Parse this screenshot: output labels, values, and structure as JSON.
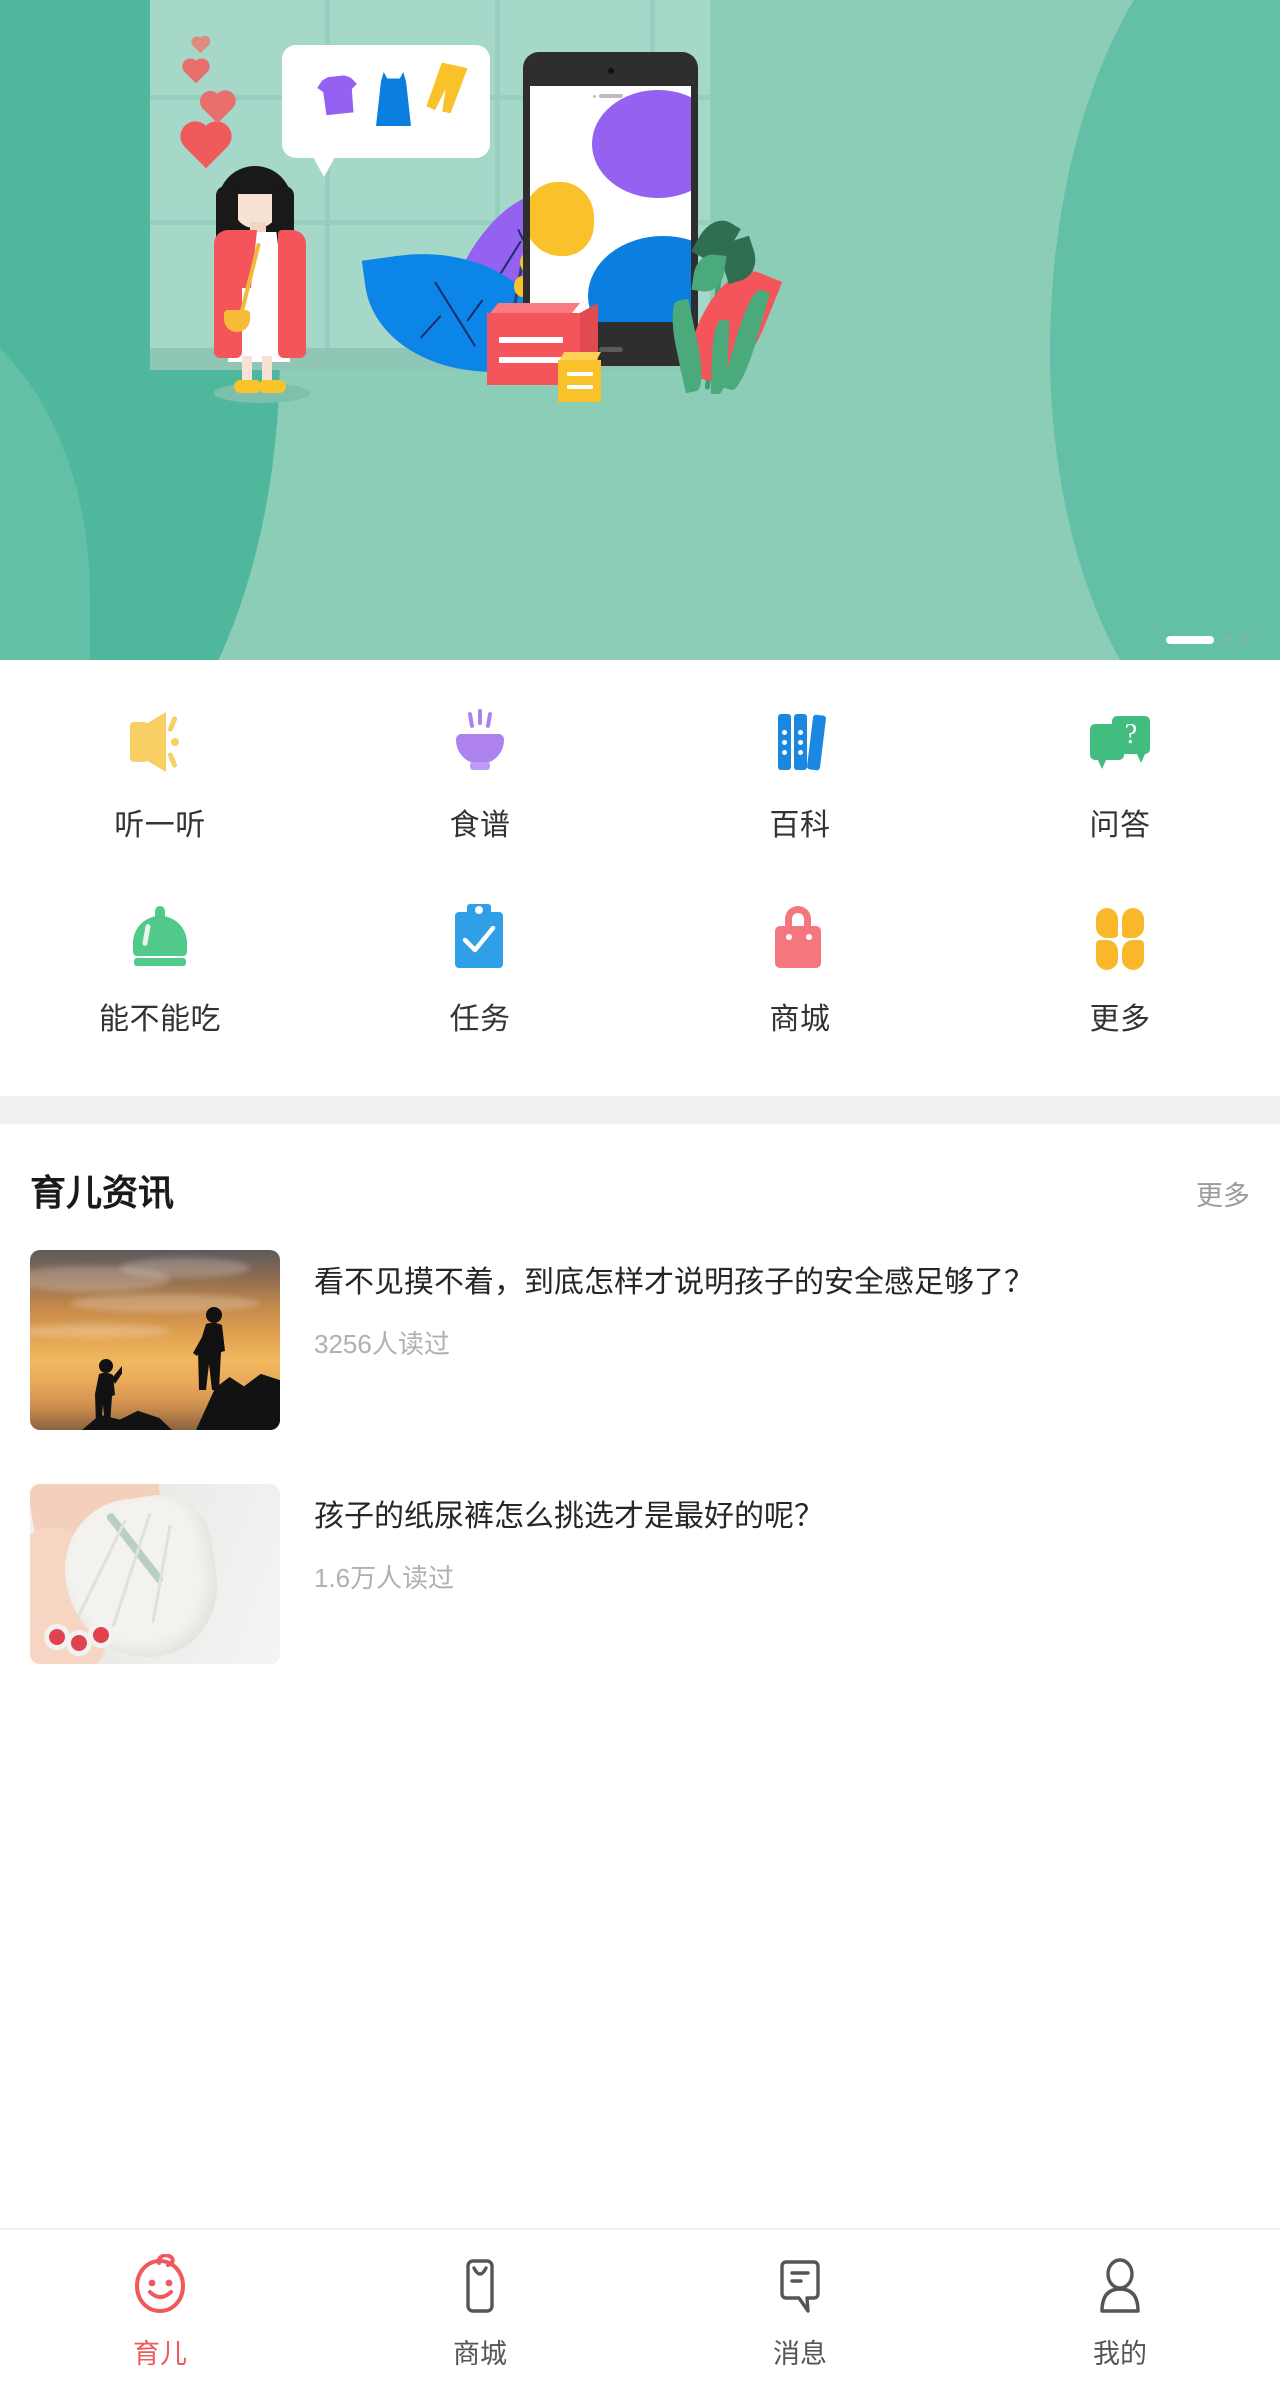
{
  "banner": {
    "name": "promo-banner",
    "slide_count": 3,
    "active_slide": 1,
    "indicator_active_color": "#ffffff",
    "indicator_inactive_color": "#76b9a5",
    "background_color": "#8ccdb8"
  },
  "quick_links": {
    "rows": [
      [
        {
          "label": "听一听",
          "icon": "speaker-icon",
          "color": "#f8cf62"
        },
        {
          "label": "食谱",
          "icon": "soup-bowl-icon",
          "color": "#ad82f0"
        },
        {
          "label": "百科",
          "icon": "books-icon",
          "color": "#1a87e0"
        },
        {
          "label": "问答",
          "icon": "question-chat-icon",
          "color": "#43bd7f"
        }
      ],
      [
        {
          "label": "能不能吃",
          "icon": "food-cover-icon",
          "color": "#51c98b"
        },
        {
          "label": "任务",
          "icon": "clipboard-check-icon",
          "color": "#2f9fe8"
        },
        {
          "label": "商城",
          "icon": "shopping-bag-icon",
          "color": "#f4777d"
        },
        {
          "label": "更多",
          "icon": "four-petal-grid-icon",
          "color": "#f9b72c"
        }
      ]
    ]
  },
  "news": {
    "section_title": "育儿资讯",
    "more_label": "更多",
    "articles": [
      {
        "title": "看不见摸不着，到底怎样才说明孩子的安全感足够了？",
        "meta": "3256人读过",
        "thumb": "sunset-helping-hand-photo"
      },
      {
        "title": "孩子的纸尿裤怎么挑选才是最好的呢？",
        "meta": "1.6万人读过",
        "thumb": "baby-diaper-photo"
      }
    ]
  },
  "tabbar": {
    "active_color": "#f0595c",
    "inactive_color": "#555555",
    "items": [
      {
        "label": "育儿",
        "icon": "baby-face-icon",
        "active": true
      },
      {
        "label": "商城",
        "icon": "shopping-bag-outline-icon",
        "active": false
      },
      {
        "label": "消息",
        "icon": "message-bubble-icon",
        "active": false
      },
      {
        "label": "我的",
        "icon": "person-icon",
        "active": false
      }
    ]
  }
}
